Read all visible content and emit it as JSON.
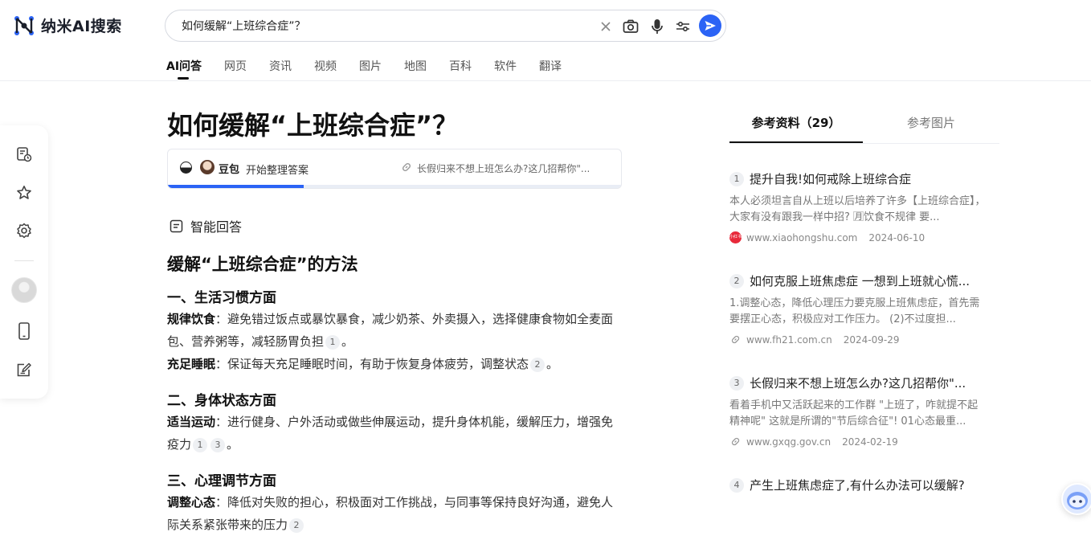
{
  "header": {
    "logo_text": "纳米AI搜索",
    "search": {
      "value": "如何缓解“上班综合症”？"
    },
    "tabs": [
      "AI问答",
      "网页",
      "资讯",
      "视频",
      "图片",
      "地图",
      "百科",
      "软件",
      "翻译"
    ],
    "active_tab": "AI问答"
  },
  "main": {
    "question_title": "如何缓解“上班综合症”？",
    "progress": {
      "model_name": "豆包",
      "status": "开始整理答案",
      "source_text": "长假归来不想上班怎么办?这几招帮你\"...",
      "fraction": 0.3
    },
    "answer_label": "智能回答",
    "answer_heading": "缓解“上班综合症”的方法",
    "sections": [
      {
        "heading": "一、生活习惯方面",
        "items": [
          {
            "term": "规律饮食",
            "text": "：避免错过饭点或暴饮暴食，减少奶茶、外卖摄入，选择健康食物如全麦面包、营养粥等，减轻肠胃负担",
            "cites": [
              "1"
            ],
            "end": "。"
          },
          {
            "term": "充足睡眠",
            "text": "：保证每天充足睡眠时间，有助于恢复身体疲劳，调整状态",
            "cites": [
              "2"
            ],
            "end": "。"
          }
        ]
      },
      {
        "heading": "二、身体状态方面",
        "items": [
          {
            "term": "适当运动",
            "text": "：进行健身、户外活动或做些伸展运动，提升身体机能，缓解压力，增强免疫力",
            "cites": [
              "1",
              "3"
            ],
            "end": "。"
          }
        ]
      },
      {
        "heading": "三、心理调节方面",
        "items": [
          {
            "term": "调整心态",
            "text": "：降低对失败的担心，积极面对工作挑战，与同事等保持良好沟通，避免人际关系紧张带来的压力",
            "cites": [
              "2"
            ],
            "end": ""
          }
        ]
      }
    ]
  },
  "references": {
    "tab_refs": "参考资料（29）",
    "tab_images": "参考图片",
    "items": [
      {
        "num": "1",
        "title": "提升自我!如何戒除上班综合症",
        "snippet": "本人必须坦言自从上班以后培养了许多【上班综合症】，大家有没有跟我一样中招? 🈷饮食不规律 要...",
        "site": "www.xiaohongshu.com",
        "date": "2024-06-10",
        "favicon": "小红书"
      },
      {
        "num": "2",
        "title": "如何克服上班焦虑症 一想到上班就心慌...",
        "snippet": "1.调整心态，降低心理压力要克服上班焦虑症，首先需要摆正心态，积极应对工作压力。 (2)不过度担...",
        "site": "www.fh21.com.cn",
        "date": "2024-09-29",
        "favicon": ""
      },
      {
        "num": "3",
        "title": "长假归来不想上班怎么办?这几招帮你\"...",
        "snippet": "看着手机中又活跃起来的工作群 \"上班了，咋就提不起精神呢\" 这就是所谓的\"节后综合征\"! 01心态最重...",
        "site": "www.gxqg.gov.cn",
        "date": "2024-02-19",
        "favicon": ""
      },
      {
        "num": "4",
        "title": "产生上班焦虑症了,有什么办法可以缓解?"
      }
    ]
  },
  "colors": {
    "accent": "#2b63f5",
    "text": "#222222",
    "muted": "#777777",
    "brand_red": "#e8293a"
  }
}
